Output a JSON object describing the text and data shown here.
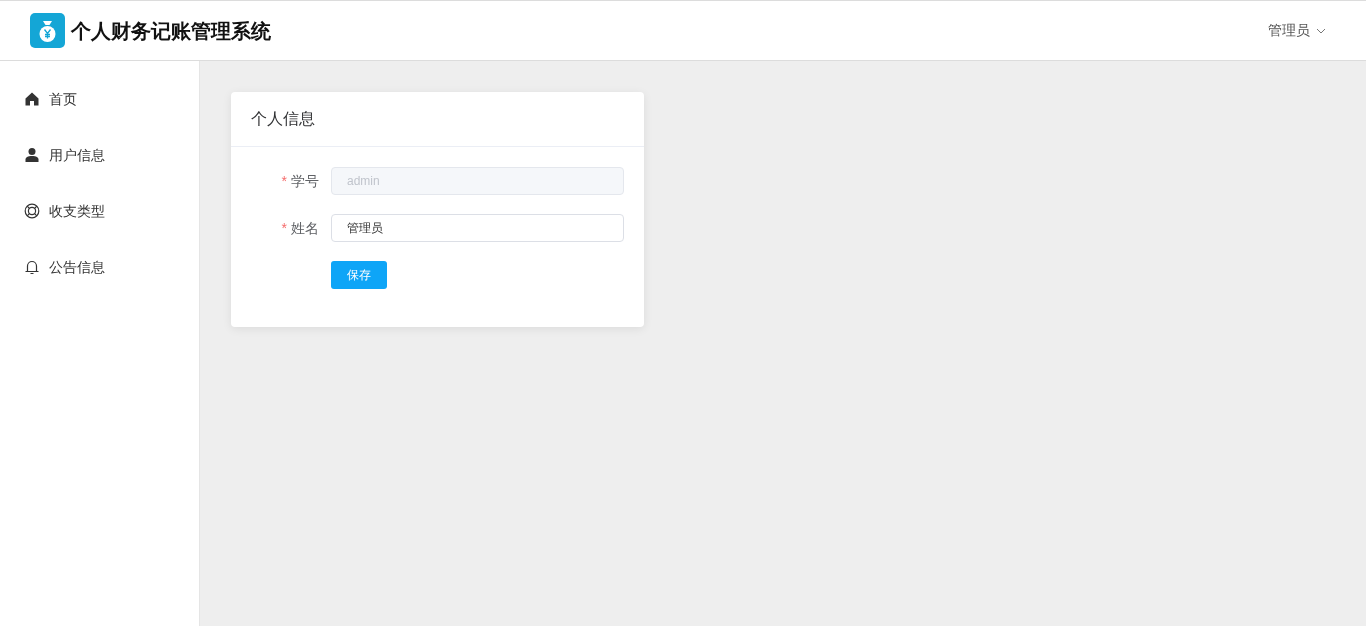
{
  "header": {
    "title": "个人财务记账管理系统",
    "user": "管理员"
  },
  "sidebar": {
    "items": [
      {
        "label": "首页"
      },
      {
        "label": "用户信息"
      },
      {
        "label": "收支类型"
      },
      {
        "label": "公告信息"
      }
    ]
  },
  "card": {
    "title": "个人信息",
    "fields": [
      {
        "required_mark": "*",
        "label": "学号",
        "value": "admin",
        "disabled": true
      },
      {
        "required_mark": "*",
        "label": "姓名",
        "value": "管理员",
        "disabled": false
      }
    ],
    "button": "保存"
  }
}
